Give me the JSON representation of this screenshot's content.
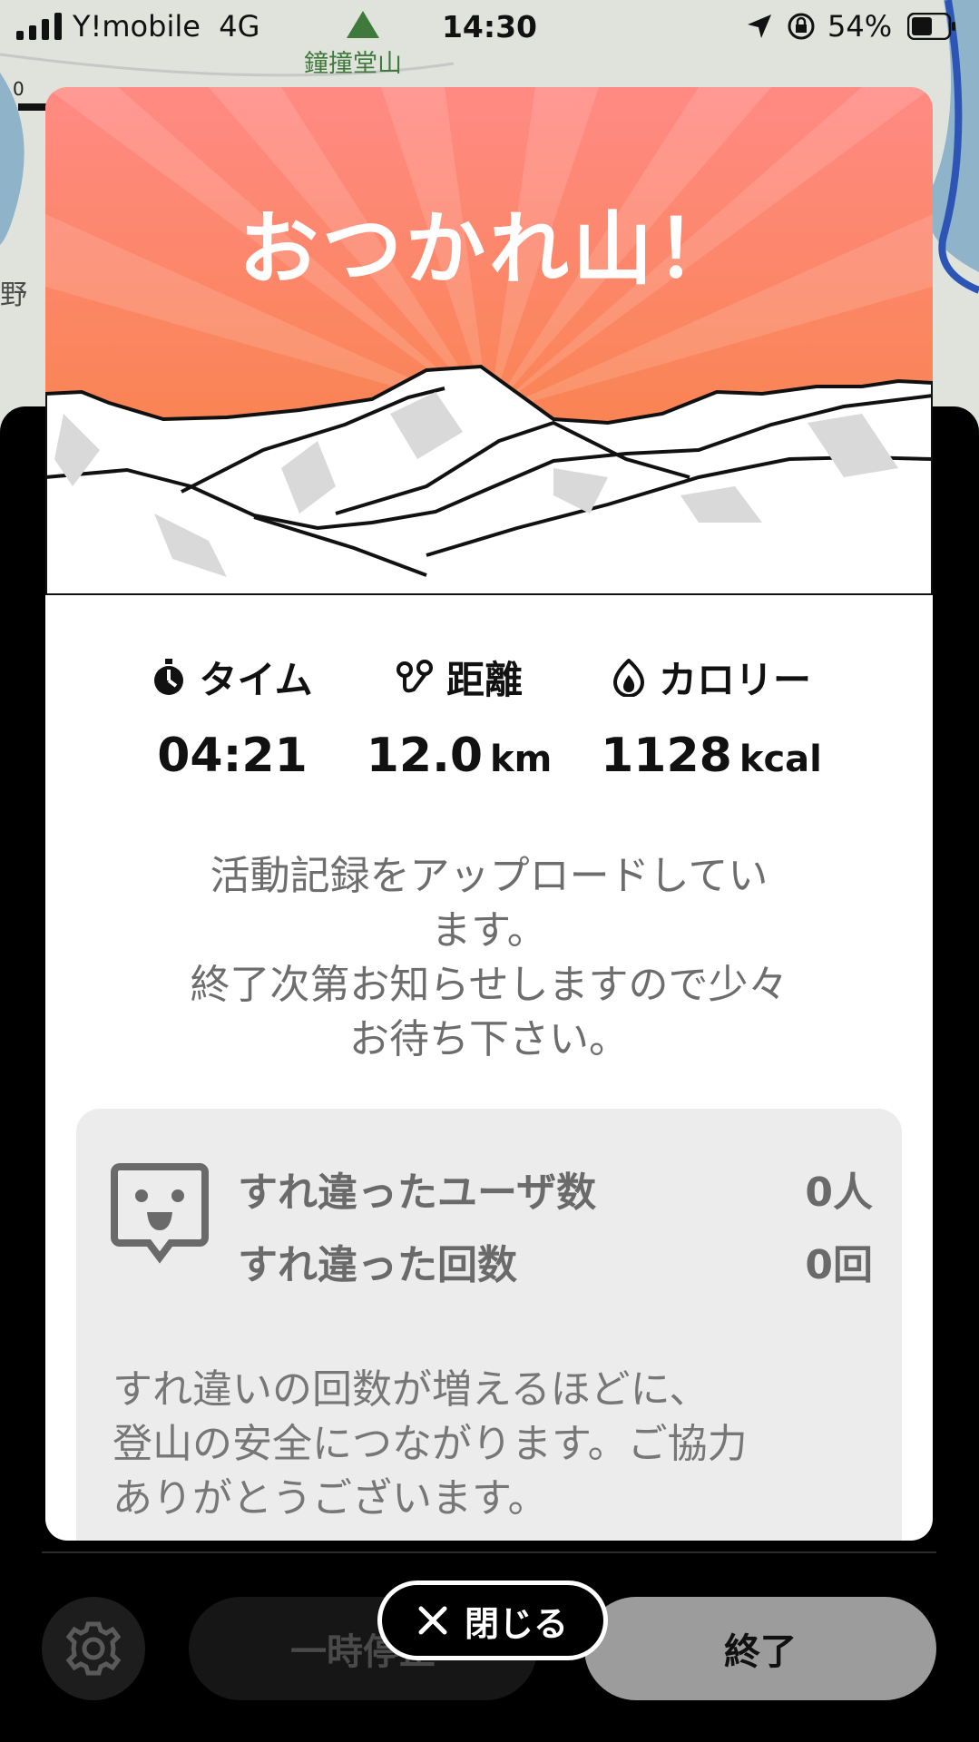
{
  "status_bar": {
    "carrier": "Y!mobile",
    "network": "4G",
    "time": "14:30",
    "battery": "54%"
  },
  "map": {
    "place_label": "鐘撞堂山",
    "left_label": "野",
    "scale_start": "0"
  },
  "modal": {
    "title": "おつかれ山！",
    "stats": [
      {
        "label": "タイム",
        "value": "04:21",
        "unit": "",
        "icon": "stopwatch-icon"
      },
      {
        "label": "距離",
        "value": "12.0",
        "unit": "km",
        "icon": "route-icon"
      },
      {
        "label": "カロリー",
        "value": "1128",
        "unit": "kcal",
        "icon": "flame-icon"
      }
    ],
    "upload_message": [
      "活動記録をアップロードしてい",
      "ます。",
      "終了次第お知らせしますので少々",
      "お待ち下さい。"
    ],
    "passing": {
      "users_label": "すれ違ったユーザ数",
      "users_value": "0人",
      "count_label": "すれ違った回数",
      "count_value": "0回",
      "note": [
        "すれ違いの回数が増えるほどに、",
        "登山の安全につながります。ご協力",
        "ありがとうございます。"
      ]
    }
  },
  "close_button": {
    "label": "閉じる"
  },
  "controls": {
    "pause_label": "一時停止",
    "end_label": "終了"
  },
  "colors": {
    "hero_top": "#ff8a84",
    "hero_bottom": "#f7813a"
  }
}
